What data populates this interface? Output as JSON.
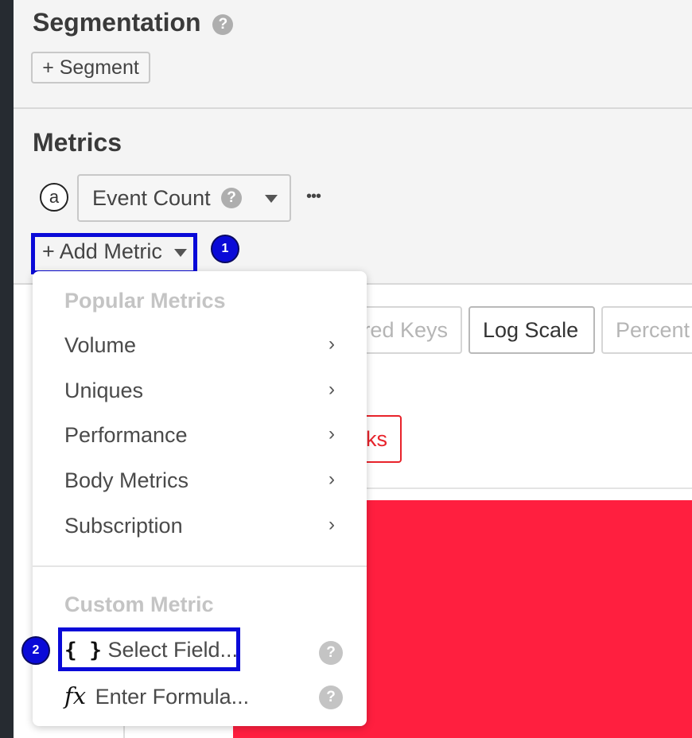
{
  "segmentation": {
    "title": "Segmentation",
    "help": "?",
    "add_segment": "+ Segment"
  },
  "metrics": {
    "title": "Metrics",
    "letter": "a",
    "selected_metric": "Event Count",
    "help": "?",
    "more": "•••",
    "add_metric": "+ Add Metric"
  },
  "annotations": {
    "badge1": "1",
    "badge2": "2"
  },
  "background": {
    "toggle1": "red Keys",
    "toggle2": "Log Scale",
    "toggle3": "Percent",
    "red_button": "ks"
  },
  "dropdown": {
    "popular_header": "Popular Metrics",
    "popular_items": [
      {
        "label": "Volume",
        "chevron": "›"
      },
      {
        "label": "Uniques",
        "chevron": "›"
      },
      {
        "label": "Performance",
        "chevron": "›"
      },
      {
        "label": "Body Metrics",
        "chevron": "›"
      },
      {
        "label": "Subscription",
        "chevron": "›"
      }
    ],
    "custom_header": "Custom Metric",
    "select_field": {
      "icon": "{ }",
      "label": "Select Field...",
      "help": "?"
    },
    "enter_formula": {
      "icon": "fx",
      "label": "Enter Formula...",
      "help": "?"
    }
  },
  "colors": {
    "highlight": "#0a0ad8",
    "chart_red": "#ff1f3f",
    "sidebar": "#262b31"
  }
}
